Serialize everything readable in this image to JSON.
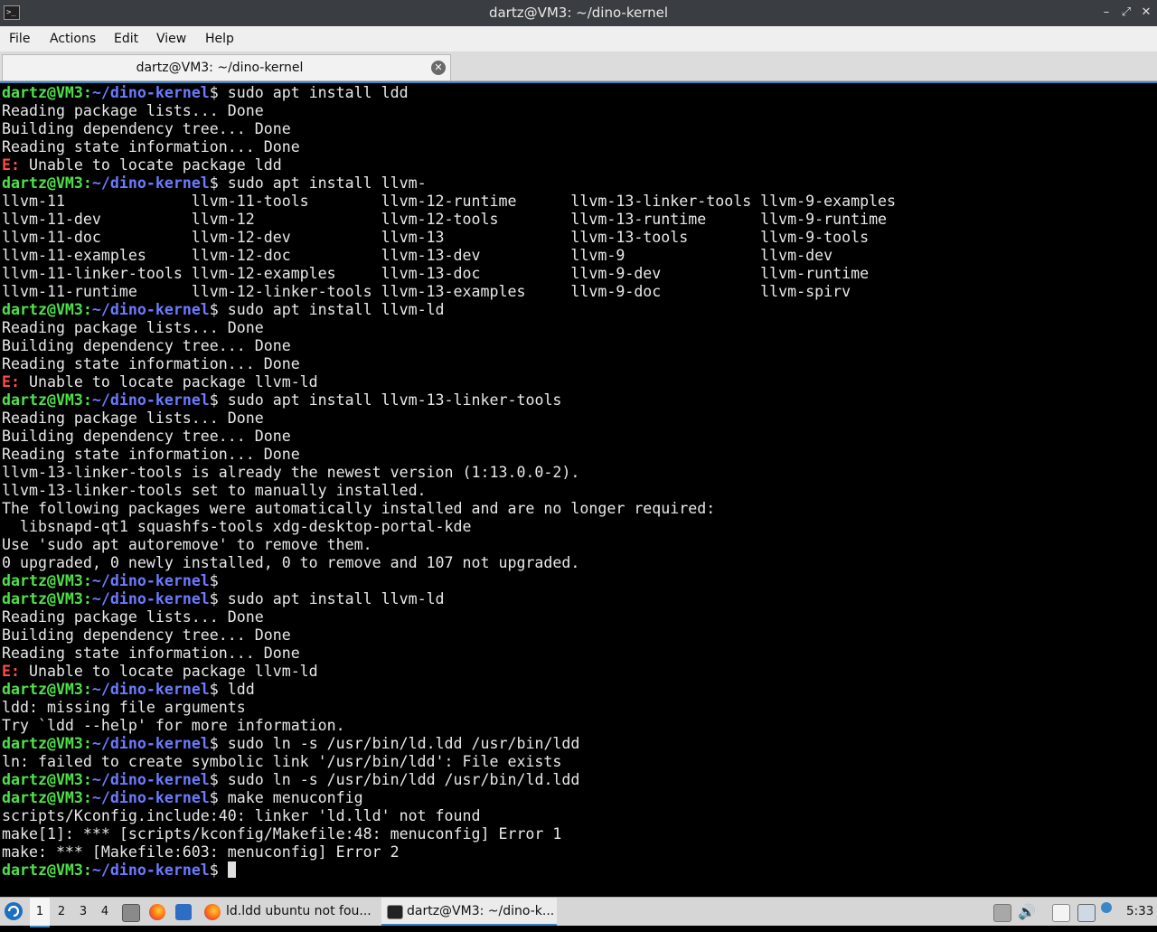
{
  "window": {
    "title": "dartz@VM3: ~/dino-kernel",
    "buttons": {
      "minimize": "–",
      "maximize": "⤢",
      "close": "✕"
    }
  },
  "menubar": {
    "items": [
      "File",
      "Actions",
      "Edit",
      "View",
      "Help"
    ]
  },
  "tabs": [
    {
      "label": "dartz@VM3: ~/dino-kernel",
      "close": "✕"
    }
  ],
  "terminal": {
    "lines": [
      {
        "type": "prompt",
        "user": "dartz@VM3",
        "path": "~/dino-kernel",
        "cmd": "sudo apt install ldd"
      },
      {
        "type": "text",
        "text": "Reading package lists... Done"
      },
      {
        "type": "text",
        "text": "Building dependency tree... Done"
      },
      {
        "type": "text",
        "text": "Reading state information... Done"
      },
      {
        "type": "error",
        "label": "E:",
        "text": " Unable to locate package ldd"
      },
      {
        "type": "prompt",
        "user": "dartz@VM3",
        "path": "~/dino-kernel",
        "cmd": "sudo apt install llvm-"
      },
      {
        "type": "text",
        "text": "llvm-11              llvm-11-tools        llvm-12-runtime      llvm-13-linker-tools llvm-9-examples"
      },
      {
        "type": "text",
        "text": "llvm-11-dev          llvm-12              llvm-12-tools        llvm-13-runtime      llvm-9-runtime"
      },
      {
        "type": "text",
        "text": "llvm-11-doc          llvm-12-dev          llvm-13              llvm-13-tools        llvm-9-tools"
      },
      {
        "type": "text",
        "text": "llvm-11-examples     llvm-12-doc          llvm-13-dev          llvm-9               llvm-dev"
      },
      {
        "type": "text",
        "text": "llvm-11-linker-tools llvm-12-examples     llvm-13-doc          llvm-9-dev           llvm-runtime"
      },
      {
        "type": "text",
        "text": "llvm-11-runtime      llvm-12-linker-tools llvm-13-examples     llvm-9-doc           llvm-spirv"
      },
      {
        "type": "prompt",
        "user": "dartz@VM3",
        "path": "~/dino-kernel",
        "cmd": "sudo apt install llvm-ld"
      },
      {
        "type": "text",
        "text": "Reading package lists... Done"
      },
      {
        "type": "text",
        "text": "Building dependency tree... Done"
      },
      {
        "type": "text",
        "text": "Reading state information... Done"
      },
      {
        "type": "error",
        "label": "E:",
        "text": " Unable to locate package llvm-ld"
      },
      {
        "type": "prompt",
        "user": "dartz@VM3",
        "path": "~/dino-kernel",
        "cmd": "sudo apt install llvm-13-linker-tools"
      },
      {
        "type": "text",
        "text": "Reading package lists... Done"
      },
      {
        "type": "text",
        "text": "Building dependency tree... Done"
      },
      {
        "type": "text",
        "text": "Reading state information... Done"
      },
      {
        "type": "text",
        "text": "llvm-13-linker-tools is already the newest version (1:13.0.0-2)."
      },
      {
        "type": "text",
        "text": "llvm-13-linker-tools set to manually installed."
      },
      {
        "type": "text",
        "text": "The following packages were automatically installed and are no longer required:"
      },
      {
        "type": "text",
        "text": "  libsnapd-qt1 squashfs-tools xdg-desktop-portal-kde"
      },
      {
        "type": "text",
        "text": "Use 'sudo apt autoremove' to remove them."
      },
      {
        "type": "text",
        "text": "0 upgraded, 0 newly installed, 0 to remove and 107 not upgraded."
      },
      {
        "type": "prompt",
        "user": "dartz@VM3",
        "path": "~/dino-kernel",
        "cmd": ""
      },
      {
        "type": "prompt",
        "user": "dartz@VM3",
        "path": "~/dino-kernel",
        "cmd": "sudo apt install llvm-ld"
      },
      {
        "type": "text",
        "text": "Reading package lists... Done"
      },
      {
        "type": "text",
        "text": "Building dependency tree... Done"
      },
      {
        "type": "text",
        "text": "Reading state information... Done"
      },
      {
        "type": "error",
        "label": "E:",
        "text": " Unable to locate package llvm-ld"
      },
      {
        "type": "prompt",
        "user": "dartz@VM3",
        "path": "~/dino-kernel",
        "cmd": "ldd"
      },
      {
        "type": "text",
        "text": "ldd: missing file arguments"
      },
      {
        "type": "text",
        "text": "Try `ldd --help' for more information."
      },
      {
        "type": "prompt",
        "user": "dartz@VM3",
        "path": "~/dino-kernel",
        "cmd": "sudo ln -s /usr/bin/ld.ldd /usr/bin/ldd"
      },
      {
        "type": "text",
        "text": "ln: failed to create symbolic link '/usr/bin/ldd': File exists"
      },
      {
        "type": "prompt",
        "user": "dartz@VM3",
        "path": "~/dino-kernel",
        "cmd": "sudo ln -s /usr/bin/ldd /usr/bin/ld.ldd"
      },
      {
        "type": "prompt",
        "user": "dartz@VM3",
        "path": "~/dino-kernel",
        "cmd": "make menuconfig"
      },
      {
        "type": "text",
        "text": "scripts/Kconfig.include:40: linker 'ld.lld' not found"
      },
      {
        "type": "text",
        "text": "make[1]: *** [scripts/kconfig/Makefile:48: menuconfig] Error 1"
      },
      {
        "type": "text",
        "text": "make: *** [Makefile:603: menuconfig] Error 2"
      },
      {
        "type": "prompt",
        "user": "dartz@VM3",
        "path": "~/dino-kernel",
        "cmd": "",
        "cursor": true
      }
    ]
  },
  "taskbar": {
    "workspaces": [
      "1",
      "2",
      "3",
      "4"
    ],
    "active_workspace": "1",
    "tasks": [
      {
        "label": "ld.ldd ubuntu not fou...",
        "icon": "firefox-icon"
      },
      {
        "label": "dartz@VM3: ~/dino-k...",
        "icon": "terminal-icon"
      }
    ],
    "clock": "5:33",
    "colors": {
      "accent": "#3b87c6",
      "prompt_user": "#4fe04a",
      "prompt_path": "#6b7bff",
      "error": "#ff4b4b"
    }
  }
}
